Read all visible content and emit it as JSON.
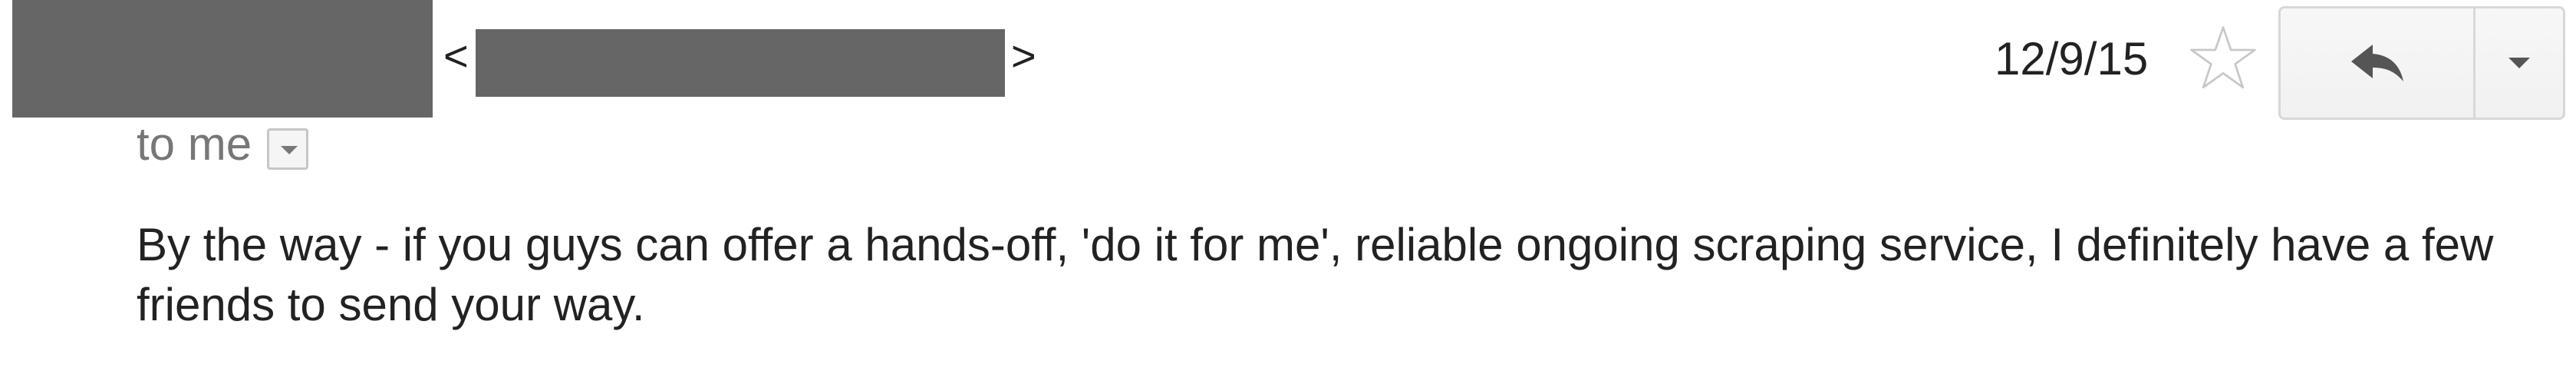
{
  "message": {
    "sender_name": "",
    "sender_email": "",
    "angle_open": "<",
    "angle_close": ">",
    "recipient_label": "to me",
    "date": "12/9/15",
    "body": "By the way - if you guys can offer a hands-off, 'do it for me', reliable ongoing scraping service, I definitely have a few friends to send your way."
  },
  "icons": {
    "details": "chevron-down-icon",
    "star": "star-outline-icon",
    "reply": "reply-arrow-icon",
    "more": "caret-down-icon"
  },
  "colors": {
    "redaction": "#666666",
    "text": "#222222",
    "muted_text": "#777777",
    "star_outline": "#c8c8c8",
    "button_border": "#d8d8d8",
    "button_icon": "#555555"
  }
}
